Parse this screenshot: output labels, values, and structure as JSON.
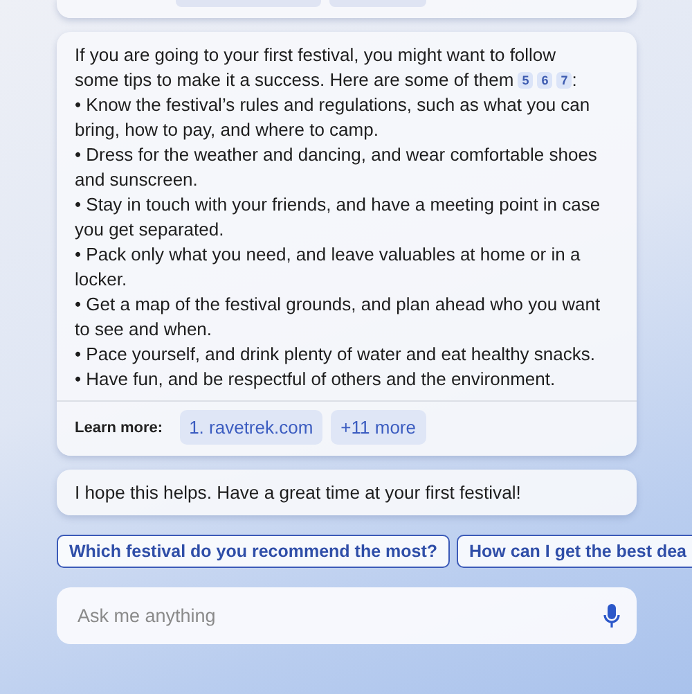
{
  "answer": {
    "intro_lines": [
      "If you are going to your first festival, you might want to follow",
      "some tips to make it a success. Here are some of them"
    ],
    "citations": [
      "5",
      "6",
      "7"
    ],
    "intro_end": ":",
    "tips": [
      "• Know the festival’s rules and regulations, such as what you can bring, how to pay, and where to camp.",
      "• Dress for the weather and dancing, and wear comfortable shoes and sunscreen.",
      "• Stay in touch with your friends, and have a meeting point in case you get separated.",
      "• Pack only what you need, and leave valuables at home or in a locker.",
      "• Get a map of the festival grounds, and plan ahead who you want to see and when.",
      "• Pace yourself, and drink plenty of water and eat healthy snacks.",
      "• Have fun, and be respectful of others and the environment."
    ],
    "learn_more": {
      "label": "Learn more:",
      "links": [
        "1. ravetrek.com",
        "+11 more"
      ]
    }
  },
  "closing": "I hope this helps. Have a great time at your first festival!",
  "suggestions": [
    "Which festival do you recommend the most?",
    "How can I get the best dea"
  ],
  "input": {
    "placeholder": "Ask me anything"
  }
}
